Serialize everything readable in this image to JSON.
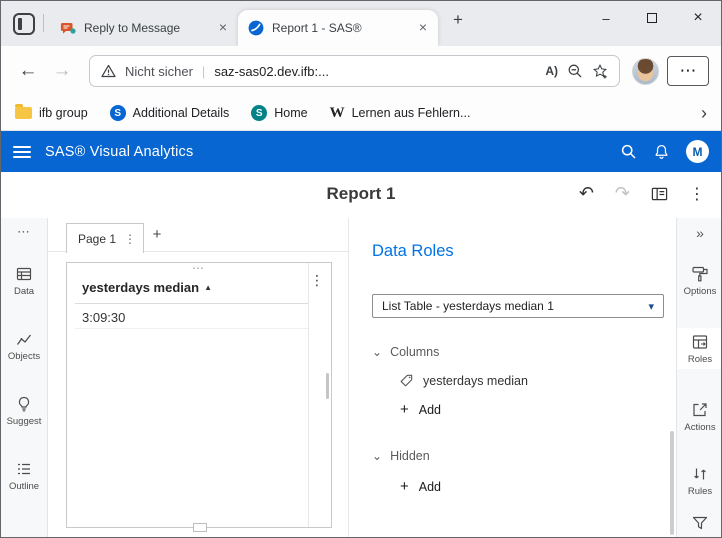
{
  "glyphs": {
    "h_dots": "⋯",
    "v_dots": "⋮",
    "plus": "+",
    "close": "×",
    "minimize": "–",
    "back": "←",
    "forward": "→",
    "collapse": "»",
    "chevron_down": "⌄",
    "chevron_right": "›",
    "caret_down": "▾",
    "undo": "↶",
    "redo": "↷",
    "separator": "|",
    "read_aloud": "A)",
    "sas_letter": "S",
    "sp_letter": "S",
    "wiki_letter": "W"
  },
  "browser": {
    "tabs": [
      {
        "title": "Reply to Message"
      },
      {
        "title": "Report 1 - SAS®"
      }
    ],
    "toolbar": {
      "security_label": "Nicht sicher",
      "url": "saz-sas02.dev.ifb:..."
    },
    "favorites": [
      {
        "label": "ifb group"
      },
      {
        "label": "Additional Details"
      },
      {
        "label": "Home"
      },
      {
        "label": "Lernen aus Fehlern..."
      }
    ]
  },
  "app": {
    "header_title": "SAS® Visual Analytics",
    "avatar_initial": "M",
    "report_title": "Report 1"
  },
  "left_rail": [
    {
      "label": "Data"
    },
    {
      "label": "Objects"
    },
    {
      "label": "Suggest"
    },
    {
      "label": "Outline"
    }
  ],
  "right_rail": [
    {
      "label": "Options"
    },
    {
      "label": "Roles"
    },
    {
      "label": "Actions"
    },
    {
      "label": "Rules"
    }
  ],
  "page": {
    "active_tab": "Page 1"
  },
  "object": {
    "title": "yesterdays median",
    "sort_indicator": "▲",
    "value": "3:09:30"
  },
  "roles_panel": {
    "title": "Data Roles",
    "selector_value": "List Table - yesterdays median 1",
    "sections": [
      {
        "label": "Columns",
        "items": [
          "yesterdays median"
        ],
        "add_label": "Add"
      },
      {
        "label": "Hidden",
        "items": [],
        "add_label": "Add"
      }
    ]
  },
  "colors": {
    "header_blue": "#0766d1",
    "accent_blue": "#0073e6"
  }
}
